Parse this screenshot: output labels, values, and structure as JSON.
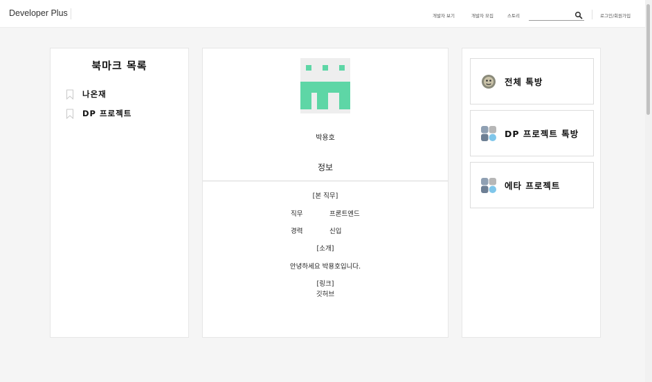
{
  "header": {
    "brand": "Developer Plus",
    "nav": [
      "개발자 보기",
      "개발자 모집",
      "스토리"
    ],
    "search": {
      "value": "",
      "placeholder": ""
    },
    "auth_label": "로그인/회원가입"
  },
  "bookmarks": {
    "title": "북마크 목록",
    "items": [
      "나온재",
      "DP 프로젝트"
    ]
  },
  "profile": {
    "name": "박용호",
    "info_title": "정보",
    "job_heading": "[본 직무]",
    "fields": [
      {
        "key": "직무",
        "value": "프론트엔드"
      },
      {
        "key": "경력",
        "value": "신입"
      }
    ],
    "intro_heading": "[소개]",
    "intro": "안녕하세요 박용호입니다.",
    "link_heading": "[링크]",
    "link": "깃허브",
    "avatar_color": "#5ed6a6"
  },
  "chat_rooms": [
    {
      "label": "전체 톡방",
      "icon": "face-avatar-icon"
    },
    {
      "label": "DP 프로젝트 톡방",
      "icon": "group-avatar-icon"
    },
    {
      "label": "에타 프로젝트",
      "icon": "group-avatar-icon"
    }
  ]
}
